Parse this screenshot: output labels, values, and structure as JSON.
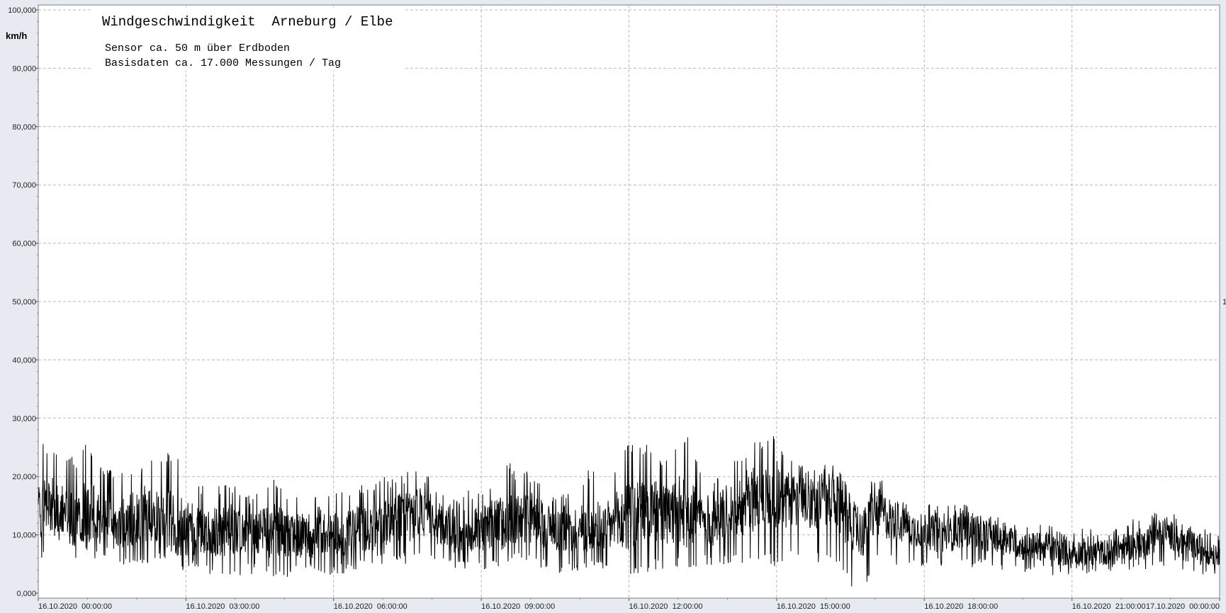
{
  "chart_data": {
    "type": "line",
    "title": "Windgeschwindigkeit  Arneburg / Elbe",
    "subtitle_lines": [
      "Sensor ca. 50 m über Erdboden",
      "Basisdaten ca. 17.000 Messungen / Tag"
    ],
    "ylabel": "km/h",
    "right_marker": "1",
    "ylim": [
      0,
      100
    ],
    "y_ticks": [
      0,
      10,
      20,
      30,
      40,
      50,
      60,
      70,
      80,
      90,
      100
    ],
    "y_tick_labels": [
      "0,000",
      "10,000",
      "20,000",
      "30,000",
      "40,000",
      "50,000",
      "60,000",
      "70,000",
      "80,000",
      "90,000",
      "100,000"
    ],
    "xlim_hours": [
      0,
      24
    ],
    "x_tick_hours": [
      0,
      3,
      6,
      9,
      12,
      15,
      18,
      21,
      24
    ],
    "x_tick_labels": [
      "16.10.2020  00:00:00",
      "16.10.2020  03:00:00",
      "16.10.2020  06:00:00",
      "16.10.2020  09:00:00",
      "16.10.2020  12:00:00",
      "16.10.2020  15:00:00",
      "16.10.2020  18:00:00",
      "16.10.2020  21:00:00",
      "17.10.2020  00:00:00"
    ],
    "grid": true,
    "series": [
      {
        "color": "#000000",
        "x_hours": [
          0,
          0.25,
          0.5,
          0.75,
          1,
          1.25,
          1.5,
          1.75,
          2,
          2.25,
          2.5,
          2.75,
          3,
          3.25,
          3.5,
          3.75,
          4,
          4.25,
          4.5,
          4.75,
          5,
          5.25,
          5.5,
          5.75,
          6,
          6.25,
          6.5,
          6.75,
          7,
          7.25,
          7.5,
          7.75,
          8,
          8.25,
          8.5,
          8.75,
          9,
          9.25,
          9.5,
          9.75,
          10,
          10.25,
          10.5,
          10.75,
          11,
          11.25,
          11.5,
          11.75,
          12,
          12.25,
          12.5,
          12.75,
          13,
          13.25,
          13.5,
          13.75,
          14,
          14.25,
          14.5,
          14.75,
          15,
          15.25,
          15.5,
          15.75,
          16,
          16.25,
          16.5,
          16.75,
          17,
          17.25,
          17.5,
          17.75,
          18,
          18.25,
          18.5,
          18.75,
          19,
          19.25,
          19.5,
          19.75,
          20,
          20.25,
          20.5,
          20.75,
          21,
          21.25,
          21.5,
          21.75,
          22,
          22.25,
          22.5,
          22.75,
          23,
          23.25,
          23.5,
          23.75,
          24
        ],
        "mean": [
          14,
          15,
          14,
          13,
          14,
          13,
          12,
          12,
          13,
          14,
          13,
          12,
          11,
          11,
          10,
          11,
          11,
          10,
          10,
          11,
          10,
          10,
          10,
          10,
          10,
          10,
          11,
          11,
          12,
          13,
          13,
          14,
          13,
          11,
          10,
          11,
          11,
          12,
          12,
          13,
          13,
          12,
          11,
          11,
          11,
          12,
          11,
          12,
          13,
          14,
          14,
          13,
          14,
          14,
          13,
          12,
          14,
          15,
          16,
          17,
          17,
          16,
          16,
          16,
          16,
          15,
          12,
          10,
          14,
          13,
          12,
          11,
          11,
          10,
          10,
          11,
          11,
          10,
          9,
          9,
          8,
          8,
          8,
          7,
          7,
          7,
          7,
          7,
          8,
          8,
          9,
          10,
          10,
          9,
          8,
          7,
          7,
          7,
          8
        ],
        "min": [
          6,
          6,
          5,
          5,
          6,
          5,
          4,
          4,
          5,
          5,
          5,
          3,
          3,
          4,
          3,
          2,
          3,
          3,
          3,
          3,
          2,
          3,
          3,
          3,
          3,
          3,
          4,
          4,
          5,
          5,
          5,
          6,
          5,
          4,
          4,
          4,
          4,
          4,
          5,
          5,
          5,
          4,
          3,
          3,
          4,
          4,
          4,
          3,
          3,
          3,
          4,
          4,
          4,
          4,
          5,
          4,
          5,
          5,
          5,
          6,
          4,
          6,
          5,
          5,
          5,
          4,
          1,
          0,
          5,
          5,
          4,
          4,
          4,
          4,
          4,
          4,
          4,
          4,
          4,
          3,
          3,
          3,
          3,
          3,
          3,
          3,
          3,
          3,
          4,
          4,
          4,
          4,
          5,
          4,
          3,
          3,
          3,
          3,
          4
        ],
        "max": [
          27,
          24,
          25,
          23,
          26,
          22,
          21,
          21,
          22,
          23,
          23,
          25,
          22,
          19,
          18,
          19,
          19,
          17,
          18,
          21,
          17,
          17,
          18,
          16,
          18,
          17,
          19,
          18,
          20,
          20,
          21,
          21,
          20,
          17,
          16,
          18,
          18,
          19,
          23,
          21,
          21,
          19,
          17,
          17,
          19,
          22,
          19,
          23,
          26,
          26,
          25,
          23,
          26,
          27,
          21,
          19,
          23,
          24,
          26,
          27,
          27,
          24,
          22,
          23,
          23,
          22,
          17,
          15,
          21,
          19,
          16,
          15,
          16,
          15,
          15,
          16,
          15,
          14,
          13,
          12,
          12,
          12,
          12,
          12,
          11,
          12,
          11,
          11,
          12,
          13,
          14,
          14,
          14,
          13,
          12,
          11,
          11,
          10,
          13
        ]
      }
    ]
  }
}
